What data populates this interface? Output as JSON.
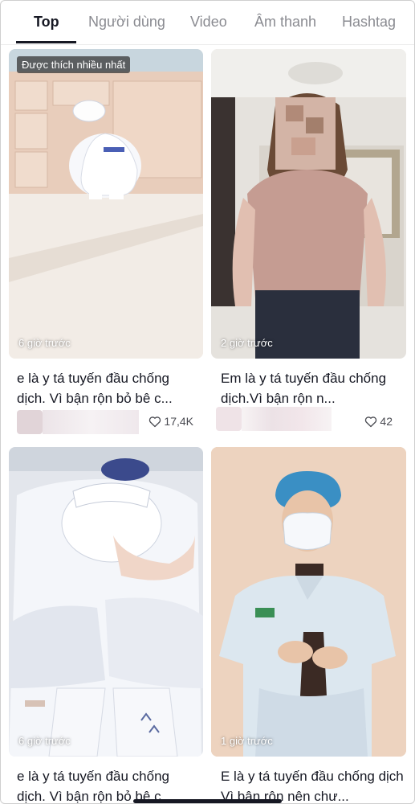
{
  "tabs": [
    "Top",
    "Người dùng",
    "Video",
    "Âm thanh",
    "Hashtag"
  ],
  "videos": [
    {
      "badge": "Được thích nhiều nhất",
      "time": "6 giờ trước",
      "description": "e là y tá tuyến đầu chống dịch. Vì bận rộn bỏ bê c...",
      "likes": "17,4K"
    },
    {
      "time": "2 giờ trước",
      "description": "Em là y tá tuyến đầu chống dịch.Vì bận rộn n...",
      "likes": "42"
    },
    {
      "time": "6 giờ trước",
      "description": "e là y tá tuyến đầu chống dịch. Vì bận rộn bỏ bê c..."
    },
    {
      "time": "1 giờ trước",
      "description": "E là y tá tuyến đầu chống dịch Vì bận rộn nên chư..."
    }
  ],
  "icons": {
    "like": "heart-outline-icon"
  },
  "colors": {
    "text": "#161823",
    "muted": "#8a8b91"
  }
}
